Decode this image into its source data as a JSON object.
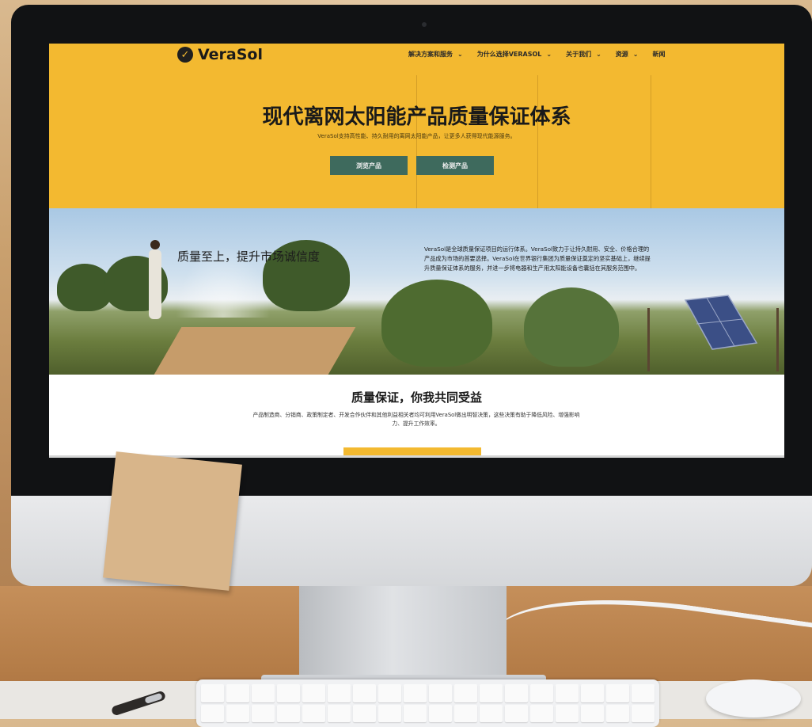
{
  "brand": {
    "name": "VeraSol",
    "logo_icon": "check-circle-icon"
  },
  "nav": [
    {
      "label": "解决方案和服务",
      "caret": "⌄"
    },
    {
      "label": "为什么选择VERASOL",
      "caret": "⌄"
    },
    {
      "label": "关于我们",
      "caret": "⌄"
    },
    {
      "label": "资源",
      "caret": "⌄"
    },
    {
      "label": "新闻",
      "caret": ""
    }
  ],
  "hero": {
    "title": "现代离网太阳能产品质量保证体系",
    "subtitle": "VeraSol支持高性能、持久耐用的离网太阳能产品，让更多人获得现代能源服务。",
    "buttons": [
      "浏览产品",
      "检测产品"
    ]
  },
  "banner": {
    "left_text": "质量至上，提升市场诚信度",
    "right_text": "VeraSol是全球质量保证项目的运行体系。VeraSol致力于让持久耐用、安全、价格合理的产品成为市场的首要选择。VeraSol在世界银行集团为质量保证奠定的坚实基础上，继续提升质量保证体系的服务，并进一步将电器和生产用太阳能设备也囊括在其服务范围中。"
  },
  "section": {
    "title": "质量保证，你我共同受益",
    "text": "产品制造商、分销商、政策制定者、开发合作伙伴和其他利益相关者均可利用VeraSol做出明智决策，这些决策有助于降低风险、增强影响力、提升工作效率。"
  },
  "colors": {
    "accent": "#f3b930",
    "button": "#3e6a5d"
  }
}
